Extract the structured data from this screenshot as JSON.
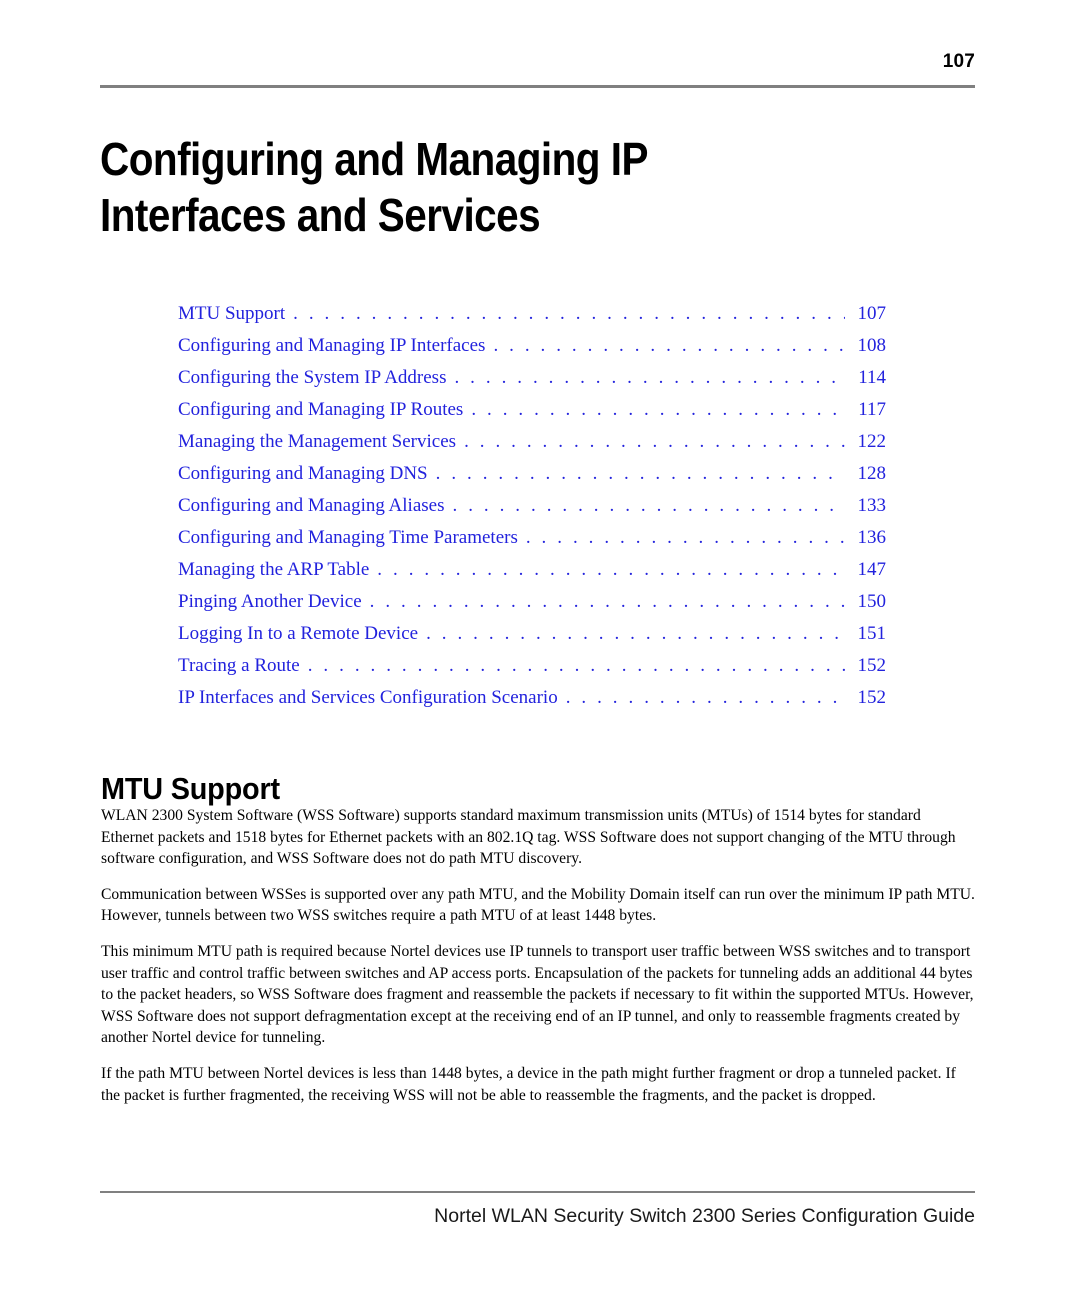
{
  "header": {
    "page_number": "107"
  },
  "chapter": {
    "title_line_1": "Configuring and Managing IP",
    "title_line_2": "Interfaces and Services"
  },
  "toc": {
    "leader": ". . . . . . . . . . . . . . . . . . . . . . . . . . . . . . . . . . . . . . . . . . . . . . . . . . . . . . . . . . . . . . . . . . . . . . . . . . . . . . . . . . . . . . . . . . . . . . . . . . . . . . . . .",
    "entries": [
      {
        "label": "MTU Support",
        "page": "107"
      },
      {
        "label": "Configuring and Managing IP Interfaces",
        "page": "108"
      },
      {
        "label": "Configuring the System IP Address",
        "page": "114"
      },
      {
        "label": "Configuring and Managing IP Routes",
        "page": "117"
      },
      {
        "label": "Managing the Management Services",
        "page": "122"
      },
      {
        "label": "Configuring and Managing DNS",
        "page": "128"
      },
      {
        "label": "Configuring and Managing Aliases",
        "page": "133"
      },
      {
        "label": "Configuring and Managing Time Parameters",
        "page": "136"
      },
      {
        "label": "Managing the ARP Table",
        "page": "147"
      },
      {
        "label": "Pinging Another Device",
        "page": "150"
      },
      {
        "label": "Logging In to a Remote Device",
        "page": "151"
      },
      {
        "label": "Tracing a Route",
        "page": "152"
      },
      {
        "label": "IP Interfaces and Services Configuration Scenario",
        "page": "152"
      }
    ]
  },
  "section": {
    "heading": "MTU Support",
    "paragraphs": [
      "WLAN 2300 System Software (WSS Software) supports standard maximum transmission units (MTUs) of 1514 bytes for standard Ethernet packets and 1518 bytes for Ethernet packets with an 802.1Q tag. WSS Software does not support changing of the MTU through software configuration, and WSS Software does not do path MTU discovery.",
      "Communication between WSSes is supported over any path MTU, and the Mobility Domain itself can run over the minimum IP path MTU. However, tunnels between two WSS switches require a path MTU of at least 1448 bytes.",
      "This minimum MTU path is required because Nortel devices use IP tunnels to transport user traffic between WSS switches and to transport user traffic and control traffic between switches and AP access ports. Encapsulation of the packets for tunneling adds an additional 44 bytes to the packet headers, so WSS Software does fragment and reassemble the packets if necessary to fit within the supported MTUs. However, WSS Software does not support defragmentation except at the receiving end of an IP tunnel, and only to reassemble fragments created by another Nortel device for tunneling.",
      "If the path MTU between Nortel devices is less than 1448 bytes, a device in the path might further fragment or drop a tunneled packet. If the packet is further fragmented, the receiving WSS will not be able to reassemble the fragments, and the packet is dropped."
    ]
  },
  "footer": {
    "text": "Nortel WLAN Security Switch 2300 Series Configuration Guide"
  },
  "colors": {
    "toc_link": "#2222dd",
    "rule": "#808080",
    "body_text": "#000000"
  }
}
